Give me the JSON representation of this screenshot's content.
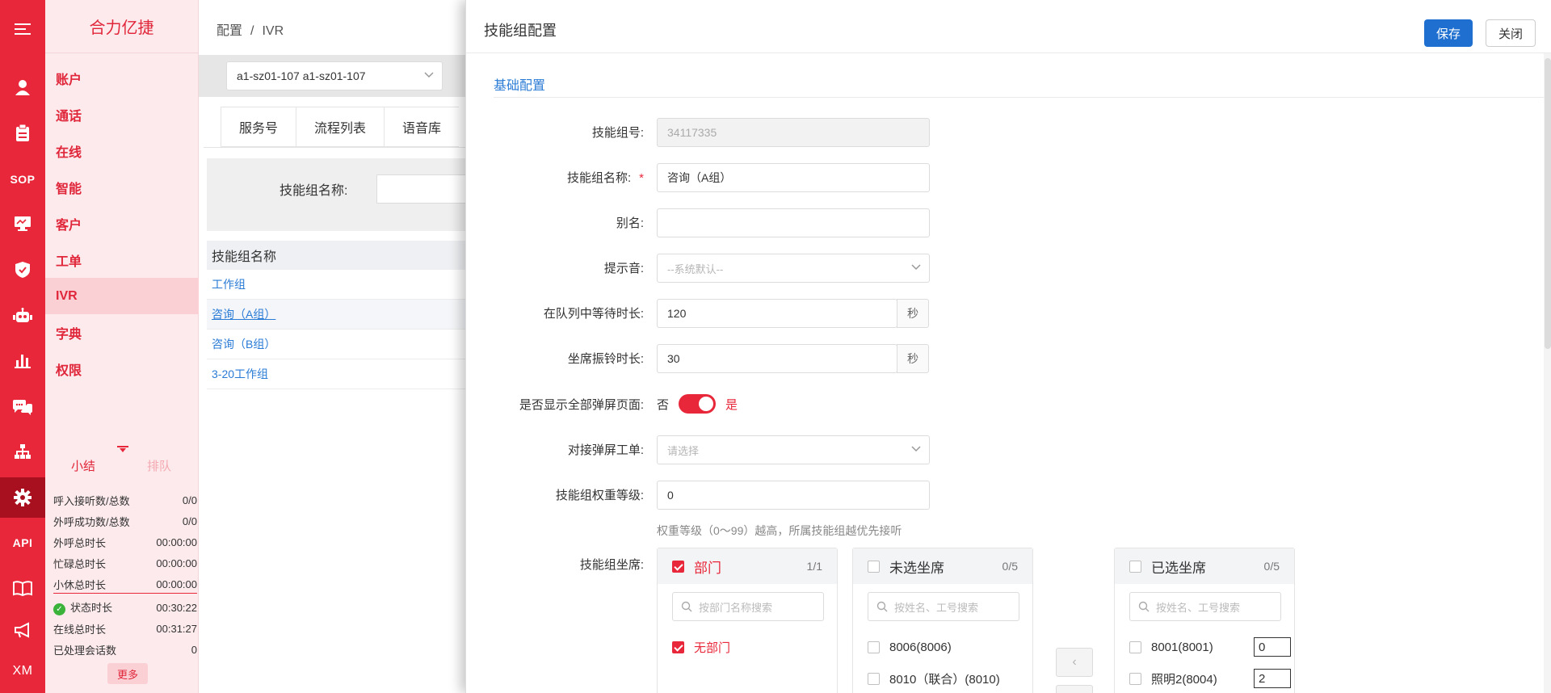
{
  "rail": {
    "bg_color": "#e8273a",
    "items": [
      {
        "icon": "menu-icon",
        "glyph": "☰"
      },
      {
        "icon": "user-icon",
        "glyph": "👤"
      },
      {
        "icon": "clipboard-icon",
        "glyph": "📋"
      },
      {
        "icon": "sop-icon",
        "text": "SOP"
      },
      {
        "icon": "monitor-icon",
        "glyph": "🖥"
      },
      {
        "icon": "shield-icon",
        "glyph": "🛡"
      },
      {
        "icon": "robot-icon",
        "glyph": "🤖"
      },
      {
        "icon": "bar-chart-icon",
        "glyph": "📊"
      },
      {
        "icon": "chat-icon",
        "glyph": "💬"
      },
      {
        "icon": "org-chart-icon",
        "glyph": "⛫"
      },
      {
        "icon": "gear-icon",
        "glyph": "⚙"
      },
      {
        "icon": "api-icon",
        "text": "API"
      },
      {
        "icon": "book-icon",
        "glyph": "📖"
      },
      {
        "icon": "megaphone-icon",
        "glyph": "📢"
      },
      {
        "icon": "xm-icon",
        "text": "XM"
      }
    ]
  },
  "menu": {
    "brand": "合力亿捷",
    "items": [
      "账户",
      "通话",
      "在线",
      "智能",
      "客户",
      "工单",
      "IVR",
      "字典",
      "权限"
    ],
    "active_index": 6
  },
  "stats": {
    "tab_summary": "小结",
    "tab_queue": "排队",
    "rows": [
      {
        "label": "呼入接听数/总数",
        "value": "0/0"
      },
      {
        "label": "外呼成功数/总数",
        "value": "0/0"
      },
      {
        "label": "外呼总时长",
        "value": "00:00:00"
      },
      {
        "label": "忙碌总时长",
        "value": "00:00:00"
      },
      {
        "label": "小休总时长",
        "value": "00:00:00"
      }
    ],
    "rows2": [
      {
        "label": "状态时长",
        "value": "00:30:22"
      },
      {
        "label": "在线总时长",
        "value": "00:31:27"
      },
      {
        "label": "已处理会话数",
        "value": "0"
      }
    ],
    "more": "更多"
  },
  "breadcrumb": {
    "root": "配置",
    "sep": "/",
    "current": "IVR"
  },
  "site_select": {
    "value": "a1-sz01-107 a1-sz01-107"
  },
  "tabs": [
    "服务号",
    "流程列表",
    "语音库"
  ],
  "filter": {
    "label": "技能组名称:"
  },
  "grid": {
    "header": "技能组名称",
    "rows": [
      "工作组",
      "咨询（A组）",
      "咨询（B组）",
      "3-20工作组"
    ],
    "hover_index": 1
  },
  "drawer": {
    "title": "技能组配置",
    "save": "保存",
    "close": "关闭",
    "section": "基础配置",
    "fields": {
      "group_no": {
        "label": "技能组号:",
        "value": "34117335"
      },
      "group_name": {
        "label": "技能组名称:",
        "required": "*",
        "value": "咨询（A组）"
      },
      "alias": {
        "label": "别名:",
        "value": ""
      },
      "tone": {
        "label": "提示音:",
        "placeholder": "--系统默认--"
      },
      "queue_wait": {
        "label": "在队列中等待时长:",
        "value": "120",
        "unit": "秒"
      },
      "ring_time": {
        "label": "坐席振铃时长:",
        "value": "30",
        "unit": "秒"
      },
      "popup_all": {
        "label": "是否显示全部弹屏页面:",
        "off": "否",
        "on": "是",
        "checked": true
      },
      "popup_ticket": {
        "label": "对接弹屏工单:",
        "placeholder": "请选择"
      },
      "weight": {
        "label": "技能组权重等级:",
        "value": "0",
        "hint": "权重等级（0～99）越高，所属技能组越优先接听"
      },
      "agents_label": "技能组坐席:"
    },
    "transfer": {
      "dept": {
        "title": "部门",
        "count": "1/1",
        "checked": true,
        "search_placeholder": "按部门名称搜索",
        "items": [
          {
            "label": "无部门",
            "checked": true
          }
        ]
      },
      "unselected": {
        "title": "未选坐席",
        "count": "0/5",
        "checked": false,
        "search_placeholder": "按姓名、工号搜索",
        "items": [
          {
            "label": "8006(8006)"
          },
          {
            "label": "8010（联合）(8010)"
          }
        ]
      },
      "selected": {
        "title": "已选坐席",
        "count": "0/5",
        "checked": false,
        "search_placeholder": "按姓名、工号搜索",
        "items": [
          {
            "label": "8001(8001)",
            "weight": "0"
          },
          {
            "label": "照明2(8004)",
            "weight": "2"
          }
        ]
      },
      "move_left": "‹"
    }
  },
  "colors": {
    "brand": "#e8273a",
    "link": "#2a7bd6",
    "primary_button": "#1e6fd0"
  }
}
